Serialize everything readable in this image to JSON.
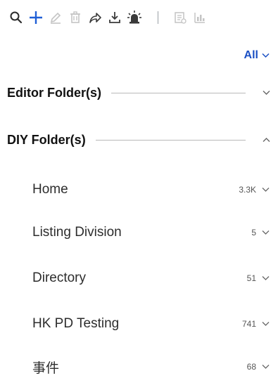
{
  "toolbar": {
    "icons": [
      "search-icon",
      "add-icon",
      "edit-icon",
      "delete-icon",
      "share-icon",
      "download-icon",
      "alert-icon",
      "report-icon",
      "chart-icon"
    ],
    "colors": {
      "active": "#1f5fd6",
      "dark": "#3a3a3a",
      "disabled": "#c4c4c4"
    }
  },
  "filter": {
    "label": "All"
  },
  "sections": {
    "editor": {
      "title": "Editor Folder(s)"
    },
    "diy": {
      "title": "DIY Folder(s)"
    }
  },
  "folders": [
    {
      "name": "Home",
      "count": "3.3K"
    },
    {
      "name": "Listing Division",
      "count": "5"
    },
    {
      "name": "Directory",
      "count": "51"
    },
    {
      "name": "HK PD Testing",
      "count": "741"
    },
    {
      "name": "事件",
      "count": "68"
    }
  ]
}
